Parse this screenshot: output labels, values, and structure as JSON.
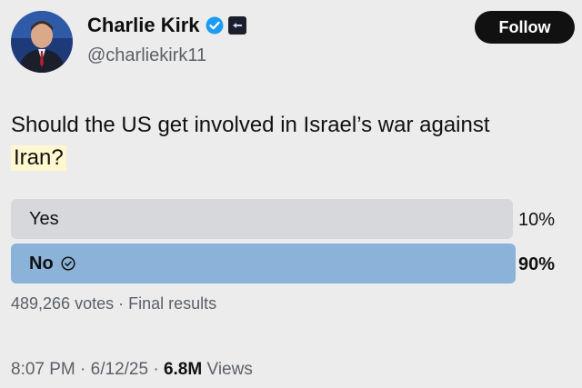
{
  "author": {
    "name": "Charlie Kirk",
    "handle": "@charliekirk11",
    "verified_color": "#1d9bf0"
  },
  "follow_label": "Follow",
  "tweet": {
    "question_main": "Should the US get involved in Israel’s war against",
    "question_highlight": "Iran?"
  },
  "poll": {
    "options": [
      {
        "label": "Yes",
        "percent": "10%",
        "share": 0.1,
        "winner": false
      },
      {
        "label": "No",
        "percent": "90%",
        "share": 0.9,
        "winner": true
      }
    ],
    "votes_text": "489,266 votes",
    "status_text": "Final results"
  },
  "footer": {
    "time": "8:07 PM",
    "date": "6/12/25",
    "views_count": "6.8M",
    "views_label": "Views"
  }
}
